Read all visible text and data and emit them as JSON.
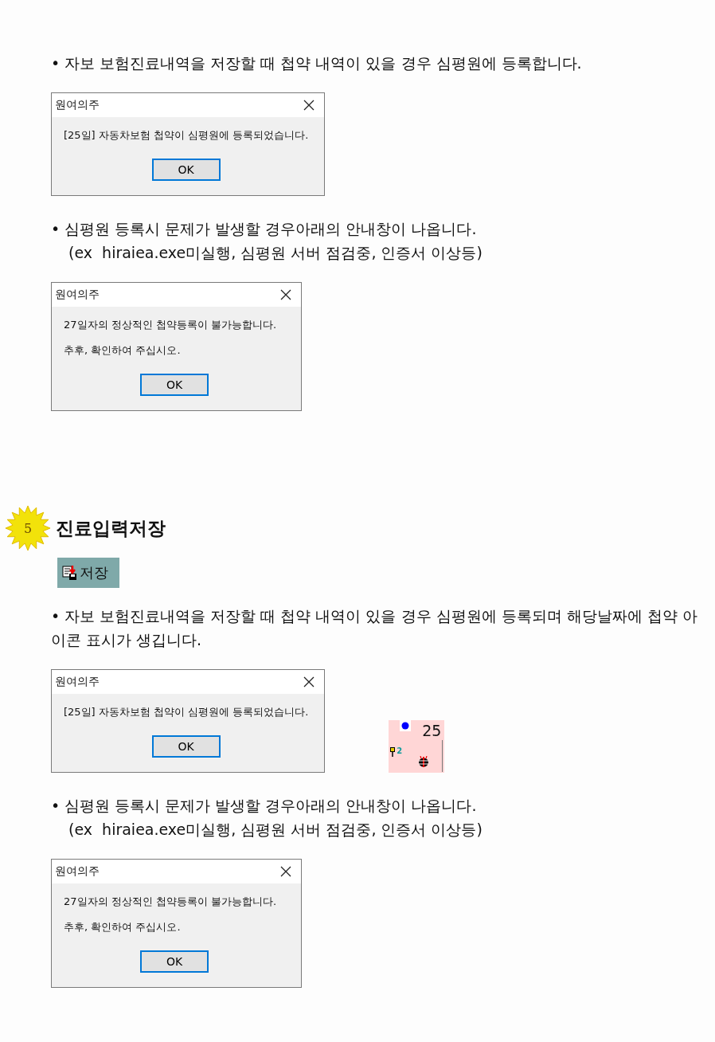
{
  "blocks": [
    {
      "kind": "bullet",
      "text": "• 자보 보험진료내역을 저장할 때 첩약 내역이 있을 경우 심평원에 등록합니다."
    },
    {
      "kind": "dialog",
      "title": "원여의주",
      "lines": [
        "[25일] 자동차보험 첩약이 심평원에 등록되었습니다."
      ],
      "button": "OK"
    },
    {
      "kind": "bullet",
      "text": "• 심평원 등록시 문제가 발생할 경우아래의 안내창이 나옵니다.",
      "note": "(ex  hiraiea.exe미실행, 심평원 서버 점검중, 인증서 이상등)"
    },
    {
      "kind": "dialog",
      "title": "원여의주",
      "lines": [
        "27일자의 정상적인 첩약등록이 불가능합니다.",
        "추후, 확인하여 주십시오."
      ],
      "button": "OK"
    },
    {
      "kind": "step",
      "number": "5",
      "title": "진료입력저장"
    },
    {
      "kind": "toolbar_button",
      "label": "저장"
    },
    {
      "kind": "bullet",
      "text": "• 자보 보험진료내역을 저장할 때 첩약 내역이 있을 경우 심평원에 등록되며 해당날짜에 첩약 아이콘 표시가 생깁니다."
    },
    {
      "kind": "dialog",
      "title": "원여의주",
      "lines": [
        "[25일] 자동차보험 첩약이 심평원에 등록되었습니다."
      ],
      "button": "OK",
      "cell": {
        "day": "25",
        "count": "2"
      }
    },
    {
      "kind": "bullet",
      "text": "• 심평원 등록시 문제가 발생할 경우아래의 안내창이 나옵니다.",
      "note": "(ex  hiraiea.exe미실행, 심평원 서버 점검중, 인증서 이상등)"
    },
    {
      "kind": "dialog",
      "title": "원여의주",
      "lines": [
        "27일자의 정상적인 첩약등록이 불가능합니다.",
        "추후, 확인하여 주십시오."
      ],
      "button": "OK"
    }
  ]
}
